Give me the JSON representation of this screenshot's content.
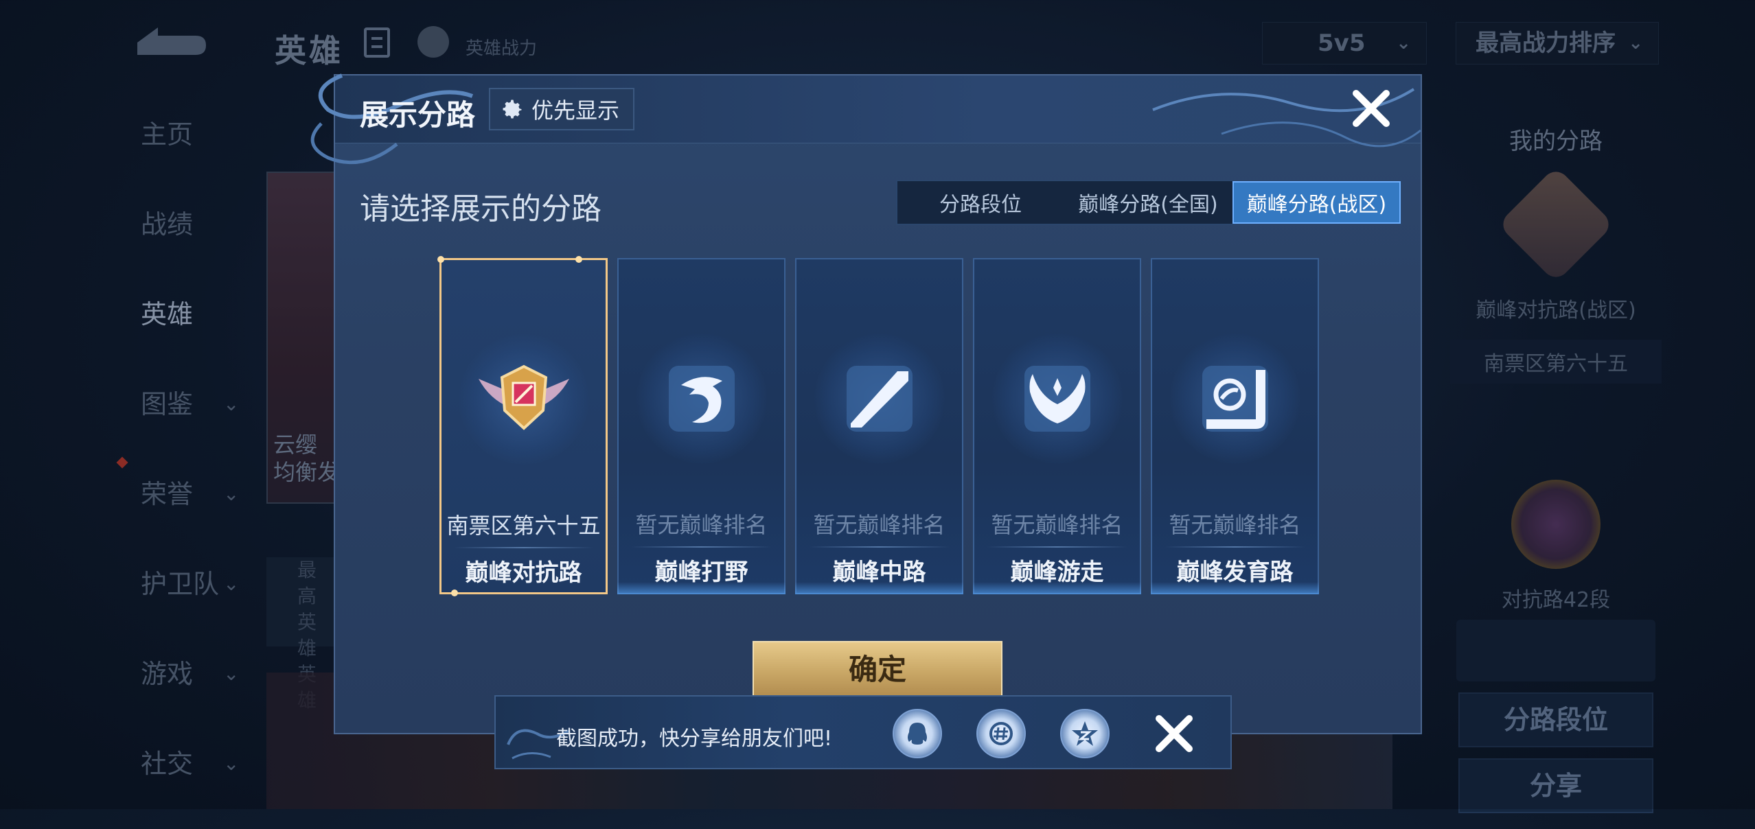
{
  "background": {
    "top_title": "英雄",
    "top_power_label": "英雄战力",
    "mode_dropdown": "5v5",
    "sort_dropdown": "最高战力排序",
    "nav": [
      "主页",
      "战绩",
      "英雄",
      "图鉴",
      "荣誉",
      "护卫队",
      "游戏",
      "社交"
    ],
    "nav_active_index": 2,
    "card_lines": [
      "云缨",
      "均衡发"
    ],
    "card2_lines": [
      "最高",
      "英雄",
      "英雄"
    ],
    "right_panel": {
      "title": "我的分路",
      "lane": "巅峰对抗路(战区)",
      "rank": "南票区第六十五",
      "segment": "对抗路42段",
      "button_lane_rank": "分路段位",
      "button_share": "分享"
    }
  },
  "modal": {
    "title": "展示分路",
    "priority_label": "优先显示",
    "subtitle": "请选择展示的分路",
    "tabs": [
      "分路段位",
      "巅峰分路(全国)",
      "巅峰分路(战区)"
    ],
    "active_tab": 2,
    "lanes": [
      {
        "rank": "南票区第六十五",
        "name": "巅峰对抗路",
        "icon": "top-lane-emblem-icon",
        "selected": true
      },
      {
        "rank": "暂无巅峰排名",
        "name": "巅峰打野",
        "icon": "jungle-dragon-icon",
        "selected": false
      },
      {
        "rank": "暂无巅峰排名",
        "name": "巅峰中路",
        "icon": "mid-lane-icon",
        "selected": false
      },
      {
        "rank": "暂无巅峰排名",
        "name": "巅峰游走",
        "icon": "roam-wings-icon",
        "selected": false
      },
      {
        "rank": "暂无巅峰排名",
        "name": "巅峰发育路",
        "icon": "bot-lane-icon",
        "selected": false
      }
    ],
    "confirm_label": "确定"
  },
  "toast": {
    "message": "截图成功，快分享给朋友们吧!",
    "share_targets": [
      "qq-icon",
      "wechat-icon",
      "qzone-icon"
    ]
  },
  "colors": {
    "selected_border": "#f3c887",
    "active_tab": "#3479c2",
    "confirm_gold": "#c9a766"
  }
}
